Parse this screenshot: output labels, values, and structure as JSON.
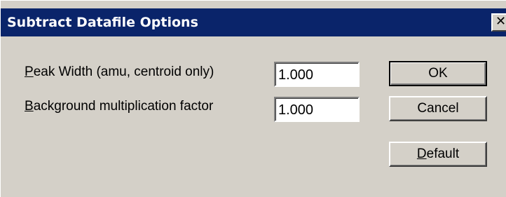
{
  "dialog": {
    "title": "Subtract Datafile Options",
    "close_glyph": "✕",
    "close_icon": "close-icon"
  },
  "fields": [
    {
      "label_accel": "P",
      "label_rest": "eak Width (amu, centroid only)",
      "value": "1.000"
    },
    {
      "label_accel": "B",
      "label_rest": "ackground multiplication factor",
      "value": "1.000"
    }
  ],
  "buttons": {
    "ok": "OK",
    "cancel": "Cancel",
    "default_accel": "D",
    "default_rest": "efault"
  }
}
